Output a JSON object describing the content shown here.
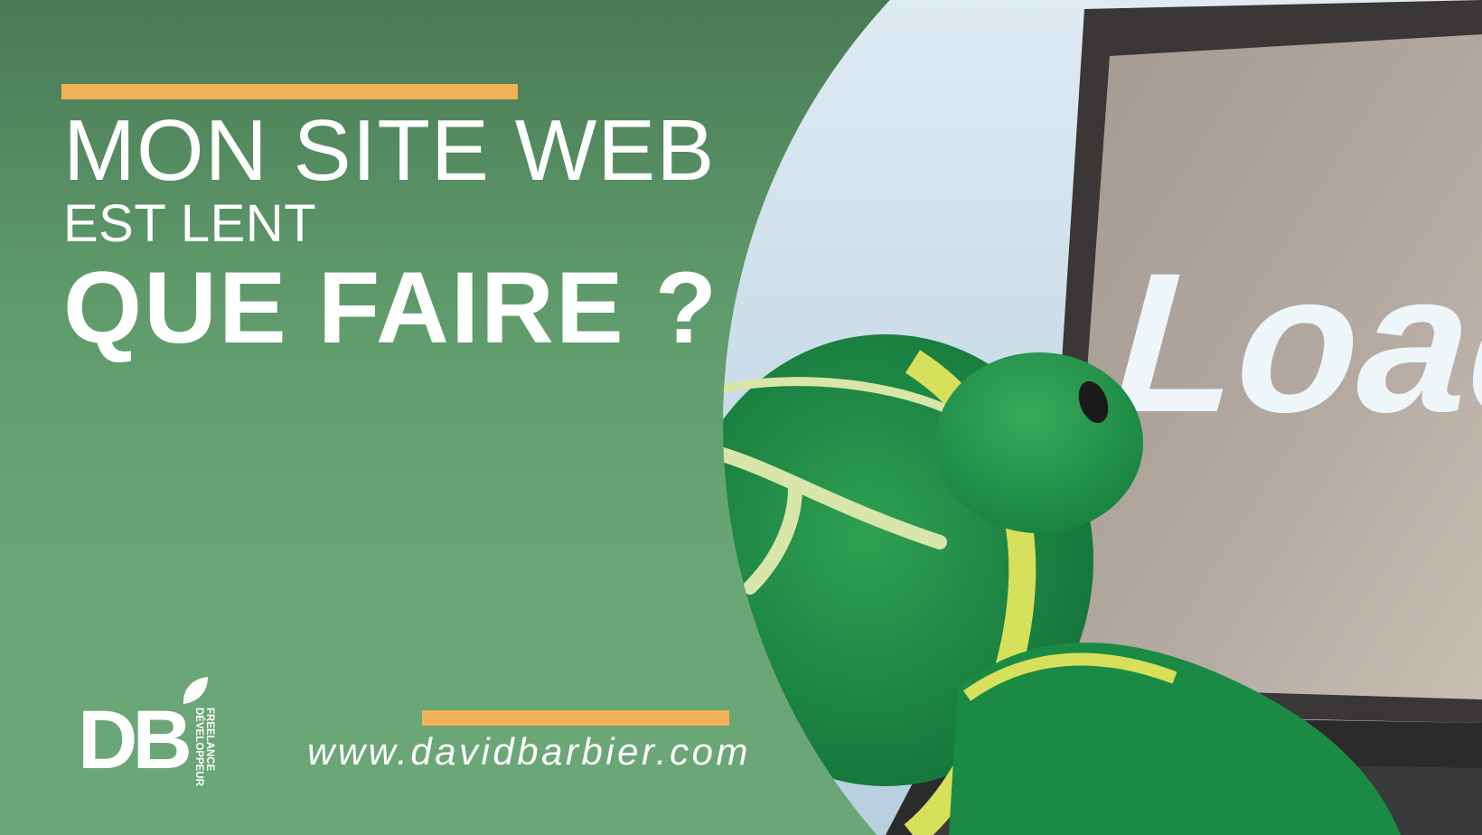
{
  "banner": {
    "title_line1": "MON SITE WEB",
    "title_line2": "EST LENT",
    "title_line3": "QUE FAIRE ?",
    "accent_color": "#f2b25a",
    "background_color": "#6aa676"
  },
  "photo": {
    "screen_text": "Load"
  },
  "logo": {
    "mark": "DB",
    "subtitle_line1": "DÉVELOPPEUR",
    "subtitle_line2": "FREELANCE",
    "icon": "leaf-icon"
  },
  "footer": {
    "url": "www.davidbarbier.com"
  }
}
